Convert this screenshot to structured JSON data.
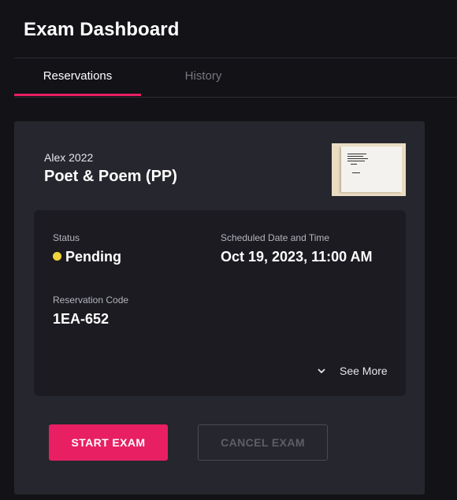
{
  "header": {
    "title": "Exam Dashboard"
  },
  "tabs": [
    {
      "label": "Reservations",
      "active": true
    },
    {
      "label": "History",
      "active": false
    }
  ],
  "reservation": {
    "subtitle": "Alex 2022",
    "exam_name": "Poet & Poem (PP)",
    "status_label": "Status",
    "status_value": "Pending",
    "status_color": "#f0d43a",
    "schedule_label": "Scheduled Date and Time",
    "schedule_value": "Oct 19, 2023, 11:00 AM",
    "code_label": "Reservation Code",
    "code_value": "1EA-652",
    "see_more_label": "See More",
    "see_more_icon": "chevron-down-icon"
  },
  "actions": {
    "start_label": "START EXAM",
    "cancel_label": "CANCEL EXAM",
    "cancel_disabled": true
  },
  "colors": {
    "accent": "#e81f63",
    "background": "#121217",
    "card": "#26262e",
    "inner_panel": "#1b1b21"
  }
}
